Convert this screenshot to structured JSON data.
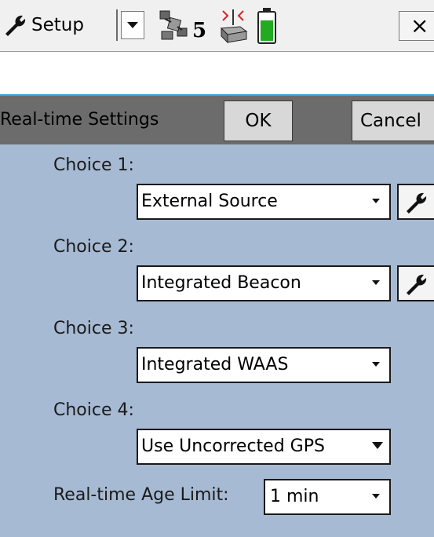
{
  "toolbar": {
    "app_menu_label": "Setup",
    "satellite_count": "5",
    "close_label": "×"
  },
  "header": {
    "title": "Real-time Settings",
    "ok_label": "OK",
    "cancel_label": "Cancel"
  },
  "choices": [
    {
      "label": "Choice 1:",
      "value": "External Source",
      "has_config": true
    },
    {
      "label": "Choice 2:",
      "value": "Integrated Beacon",
      "has_config": true
    },
    {
      "label": "Choice 3:",
      "value": "Integrated WAAS",
      "has_config": false
    },
    {
      "label": "Choice 4:",
      "value": "Use Uncorrected GPS",
      "has_config": false
    }
  ],
  "age_limit": {
    "label": "Real-time Age Limit:",
    "value": "1 min"
  },
  "icons": {
    "app": "wrench-icon",
    "satellite": "satellite-icon",
    "radio": "radio-icon",
    "battery": "battery-icon",
    "config": "wrench-icon"
  },
  "colors": {
    "battery_fill": "#22aa22",
    "header_bg": "#6c6c6c",
    "content_bg": "#a7bad3",
    "accent_line": "#33aadd"
  }
}
